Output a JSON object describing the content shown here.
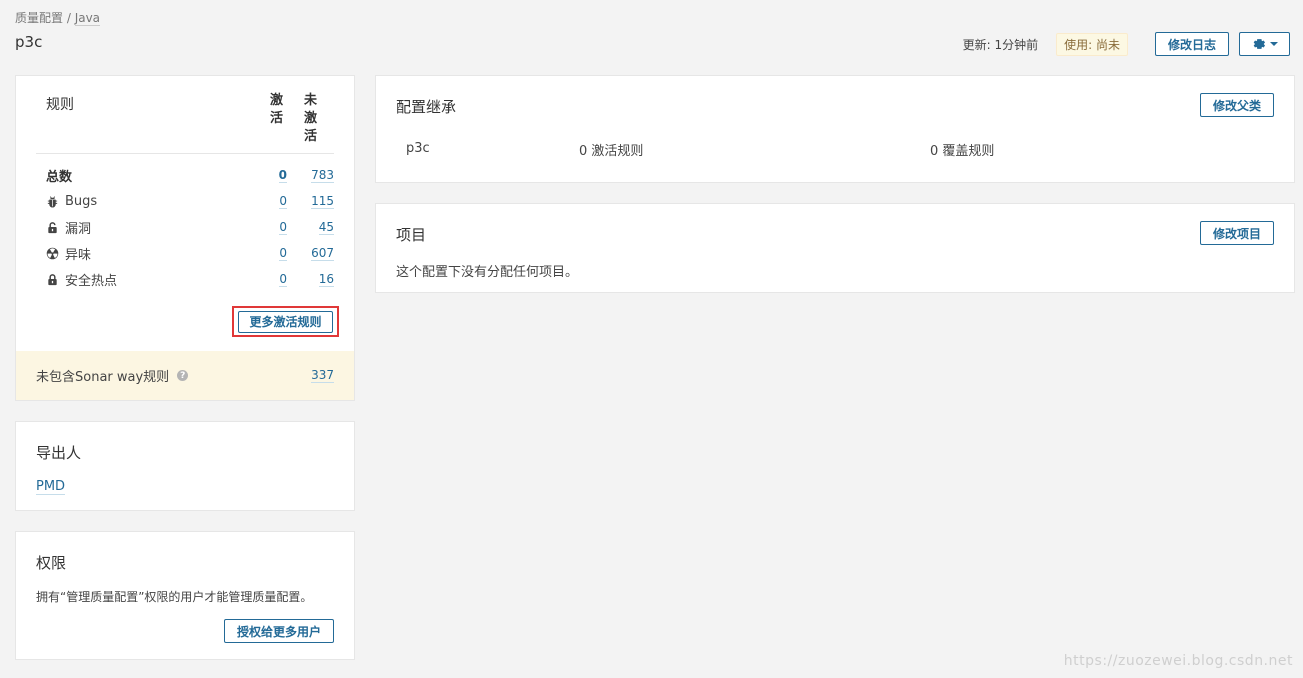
{
  "breadcrumb": {
    "root": "质量配置",
    "separator": " / ",
    "language": "Java"
  },
  "page": {
    "title": "p3c"
  },
  "header": {
    "updated": "更新: 1分钟前",
    "usage": "使用: 尚未",
    "changelog_label": "修改日志"
  },
  "rules": {
    "title": "规则",
    "col_active": "激活",
    "col_inactive": "未激活",
    "rows": [
      {
        "label": "总数",
        "icon": "none",
        "active": "0",
        "inactive": "783"
      },
      {
        "label": "Bugs",
        "icon": "bug-icon",
        "active": "0",
        "inactive": "115"
      },
      {
        "label": "漏洞",
        "icon": "lock-icon",
        "active": "0",
        "inactive": "45"
      },
      {
        "label": "异味",
        "icon": "radiation-icon",
        "active": "0",
        "inactive": "607"
      },
      {
        "label": "安全热点",
        "icon": "lock-icon",
        "active": "0",
        "inactive": "16"
      }
    ],
    "more_label": "更多激活规则",
    "sonar_text": "未包含Sonar way规则",
    "sonar_count": "337"
  },
  "exporters": {
    "title": "导出人",
    "items": [
      "PMD"
    ]
  },
  "permissions": {
    "title": "权限",
    "description": "拥有“管理质量配置”权限的用户才能管理质量配置。",
    "grant_label": "授权给更多用户"
  },
  "inheritance": {
    "title": "配置继承",
    "change_parent_label": "修改父类",
    "profile_name": "p3c",
    "active_rules": "0 激活规则",
    "overriding_rules": "0 覆盖规则"
  },
  "projects": {
    "title": "项目",
    "change_label": "修改项目",
    "empty_text": "这个配置下没有分配任何项目。"
  },
  "watermark": "https://zuozewei.blog.csdn.net",
  "colors": {
    "link": "#236a97",
    "highlight_border": "#e03838",
    "warning_bg": "#fcf6e2"
  }
}
